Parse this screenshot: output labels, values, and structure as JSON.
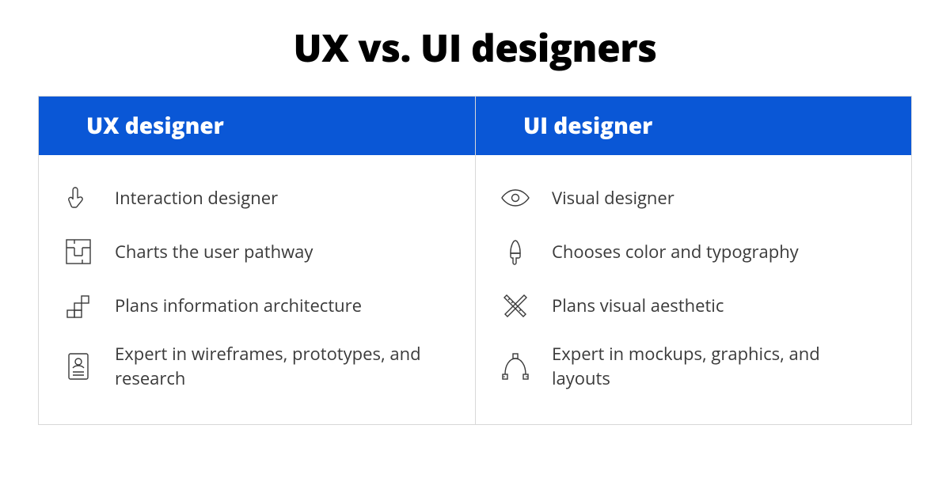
{
  "title": "UX vs. UI designers",
  "colors": {
    "accent": "#0a57d6"
  },
  "columns": [
    {
      "heading": "UX designer",
      "items": [
        {
          "icon": "pointer-hand-icon",
          "label": "Interaction designer"
        },
        {
          "icon": "maze-icon",
          "label": "Charts the user pathway"
        },
        {
          "icon": "blocks-icon",
          "label": "Plans information architecture"
        },
        {
          "icon": "profile-document-icon",
          "label": "Expert in wireframes, prototypes, and research"
        }
      ]
    },
    {
      "heading": "UI designer",
      "items": [
        {
          "icon": "eye-icon",
          "label": "Visual designer"
        },
        {
          "icon": "paintbrush-icon",
          "label": "Chooses color and typography"
        },
        {
          "icon": "pencil-ruler-icon",
          "label": "Plans visual aesthetic"
        },
        {
          "icon": "vector-curve-icon",
          "label": "Expert in mockups, graphics, and layouts"
        }
      ]
    }
  ]
}
